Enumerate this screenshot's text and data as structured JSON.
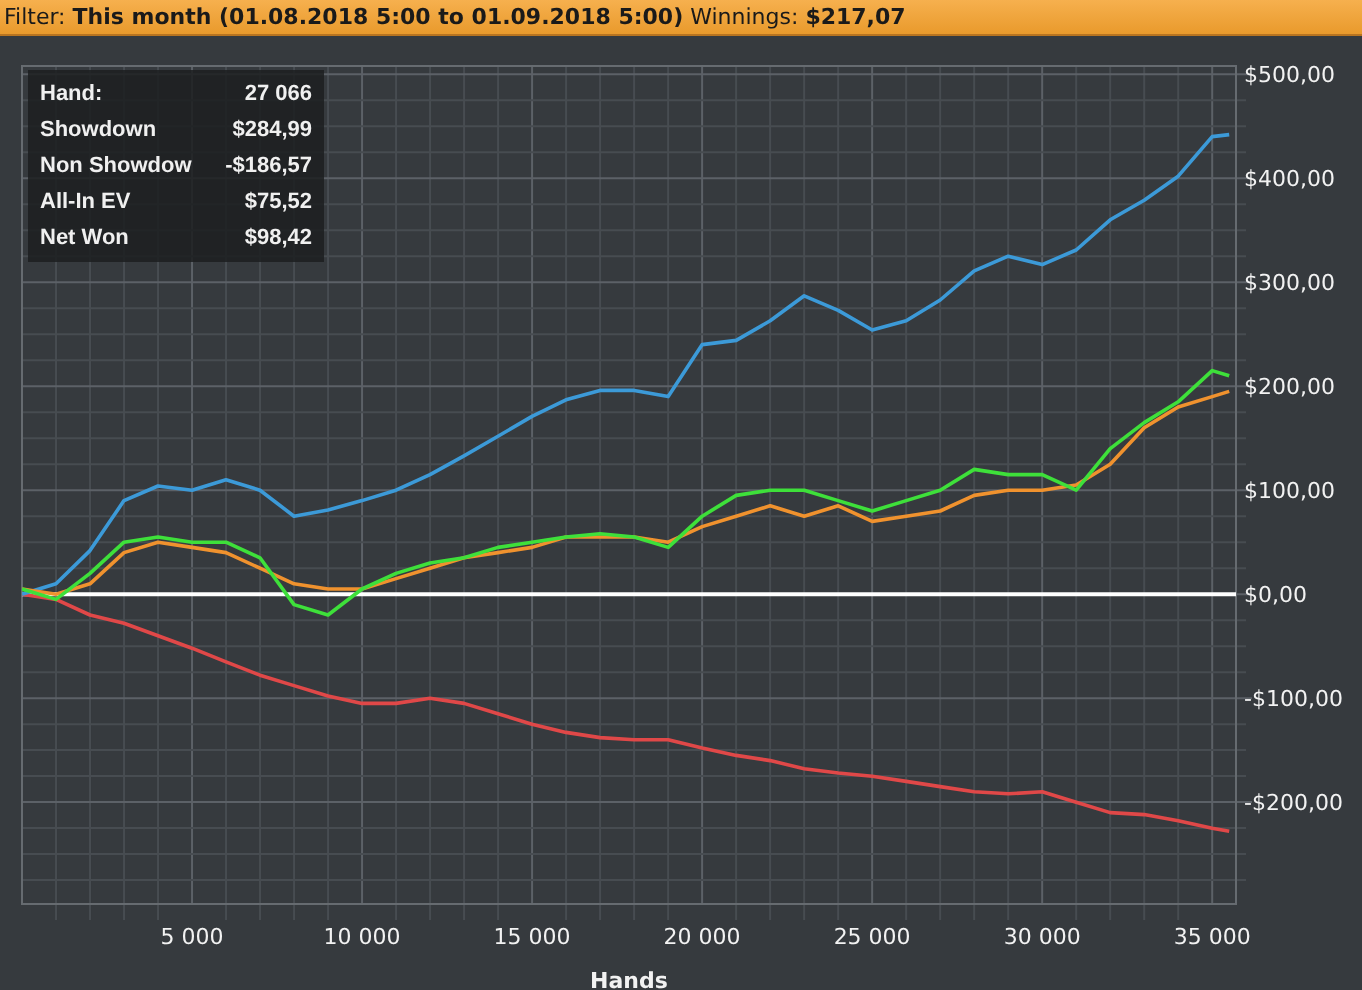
{
  "filter_bar": {
    "text": "Filter: **This month (01.08.2018 5:00 to 01.09.2018 5:00)** Winnings: **$217,07**"
  },
  "stats": [
    {
      "label": "Hand:",
      "value": "27 066"
    },
    {
      "label": "Showdown",
      "value": "$284,99"
    },
    {
      "label": "Non Showdow",
      "value": "-$186,57"
    },
    {
      "label": "All-In EV",
      "value": "$75,52"
    },
    {
      "label": "Net Won",
      "value": "$98,42"
    }
  ],
  "chart_data": {
    "type": "line",
    "grid": true,
    "xlabel": "Hands",
    "xlim": [
      0,
      35700
    ],
    "ylim": [
      -298,
      508
    ],
    "x": [
      0,
      1000,
      2000,
      3000,
      4000,
      5000,
      6000,
      7000,
      8000,
      9000,
      10000,
      11000,
      12000,
      13000,
      14000,
      15000,
      16000,
      17000,
      18000,
      19000,
      20000,
      21000,
      22000,
      23000,
      24000,
      25000,
      26000,
      27000,
      28000,
      29000,
      30000,
      31000,
      32000,
      33000,
      34000,
      35000,
      35500
    ],
    "xticks": [
      {
        "value": 5000,
        "label": "5 000"
      },
      {
        "value": 10000,
        "label": "10 000"
      },
      {
        "value": 15000,
        "label": "15 000"
      },
      {
        "value": 20000,
        "label": "20 000"
      },
      {
        "value": 25000,
        "label": "25 000"
      },
      {
        "value": 30000,
        "label": "30 000"
      },
      {
        "value": 35000,
        "label": "35 000"
      }
    ],
    "yticks": [
      {
        "value": 500,
        "label": "$500,00"
      },
      {
        "value": 400,
        "label": "$400,00"
      },
      {
        "value": 300,
        "label": "$300,00"
      },
      {
        "value": 200,
        "label": "$200,00"
      },
      {
        "value": 100,
        "label": "$100,00"
      },
      {
        "value": 0,
        "label": "$0,00"
      },
      {
        "value": -100,
        "label": "-$100,00"
      },
      {
        "value": -200,
        "label": "-$200,00"
      }
    ],
    "series": [
      {
        "color": "#e04848",
        "values": [
          0,
          -5,
          -20,
          -28,
          -40,
          -52,
          -65,
          -78,
          -88,
          -98,
          -105,
          -105,
          -100,
          -105,
          -115,
          -125,
          -133,
          -138,
          -140,
          -140,
          -148,
          -155,
          -160,
          -168,
          -172,
          -175,
          -180,
          -185,
          -190,
          -192,
          -190,
          -200,
          -210,
          -212,
          -218,
          -225,
          -228
        ]
      },
      {
        "color": "#3c9ad8",
        "values": [
          0,
          10,
          42,
          90,
          104,
          100,
          110,
          100,
          75,
          81,
          90,
          100,
          115,
          133,
          152,
          171,
          187,
          196,
          196,
          190,
          240,
          244,
          263,
          287,
          273,
          254,
          263,
          283,
          311,
          325,
          317,
          331,
          360,
          379,
          402,
          440,
          442
        ]
      },
      {
        "color": "#f0922e",
        "values": [
          5,
          0,
          10,
          40,
          50,
          45,
          40,
          25,
          10,
          5,
          5,
          15,
          25,
          35,
          40,
          45,
          55,
          55,
          55,
          50,
          65,
          75,
          85,
          75,
          85,
          70,
          75,
          80,
          95,
          100,
          100,
          105,
          125,
          160,
          180,
          190,
          195
        ]
      },
      {
        "color": "#3ee03a",
        "values": [
          5,
          -5,
          20,
          50,
          55,
          50,
          50,
          35,
          -10,
          -20,
          5,
          20,
          30,
          35,
          45,
          50,
          55,
          58,
          55,
          45,
          75,
          95,
          100,
          100,
          90,
          80,
          90,
          100,
          120,
          115,
          115,
          100,
          140,
          165,
          185,
          215,
          210
        ]
      }
    ]
  }
}
